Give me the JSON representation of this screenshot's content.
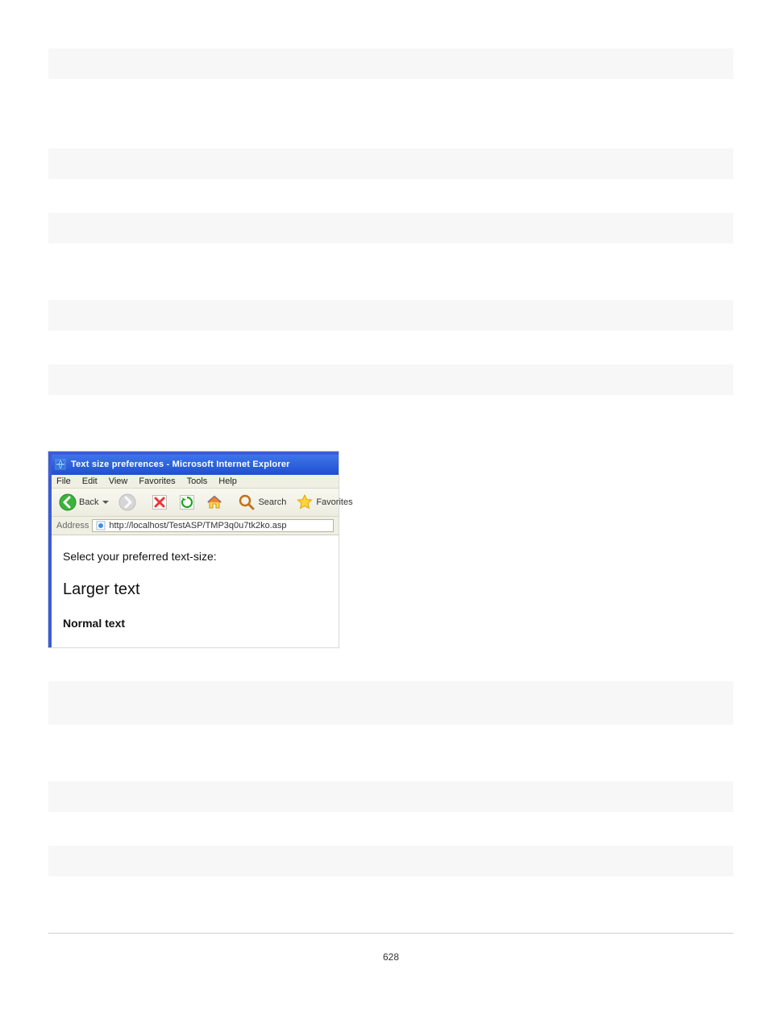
{
  "page_number": "628",
  "ie": {
    "title": "Text size preferences - Microsoft Internet Explorer",
    "menu": {
      "file": "File",
      "edit": "Edit",
      "view": "View",
      "favorites": "Favorites",
      "tools": "Tools",
      "help": "Help"
    },
    "toolbar": {
      "back_label": "Back",
      "search_label": "Search",
      "favorites_label": "Favorites"
    },
    "address": {
      "label": "Address",
      "value": "http://localhost/TestASP/TMP3q0u7tk2ko.asp"
    },
    "content": {
      "prompt": "Select your preferred text-size:",
      "larger": "Larger text",
      "normal": "Normal text"
    }
  }
}
